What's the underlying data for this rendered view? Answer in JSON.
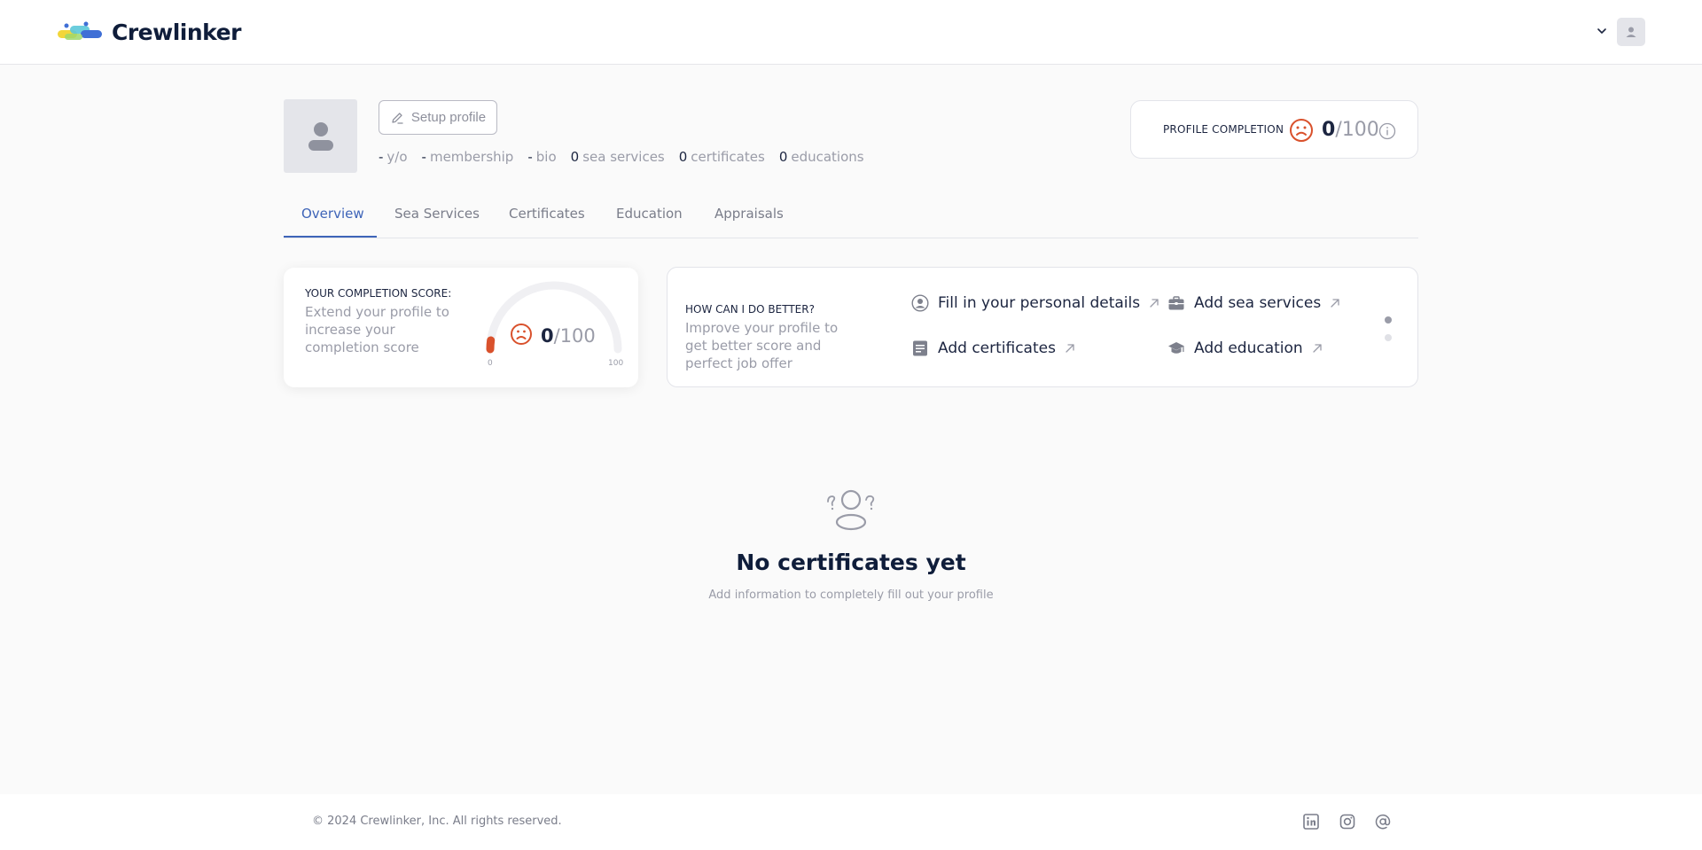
{
  "header": {
    "brand": "Crewlinker"
  },
  "profile": {
    "setup_label": "Setup profile",
    "stats": [
      {
        "value": "-",
        "label": "y/o"
      },
      {
        "value": "-",
        "label": "membership"
      },
      {
        "value": "-",
        "label": "bio"
      },
      {
        "value": "0",
        "label": "sea services"
      },
      {
        "value": "0",
        "label": "certificates"
      },
      {
        "value": "0",
        "label": "educations"
      }
    ],
    "completion": {
      "label": "PROFILE COMPLETION",
      "score": "0",
      "max": "/100"
    }
  },
  "tabs": [
    {
      "label": "Overview",
      "active": true
    },
    {
      "label": "Sea Services"
    },
    {
      "label": "Certificates"
    },
    {
      "label": "Education"
    },
    {
      "label": "Appraisals"
    }
  ],
  "score_card": {
    "title": "YOUR COMPLETION SCORE:",
    "description": "Extend your profile to increase your completion score",
    "score": "0",
    "max": "/100",
    "gauge_min": "0",
    "gauge_max": "100",
    "gauge_fraction": 0.0
  },
  "better_card": {
    "title": "HOW CAN I DO BETTER?",
    "description": "Improve your profile to get better score and perfect job offer",
    "actions": [
      {
        "label": "Fill in your personal details",
        "icon": "user-circle-icon"
      },
      {
        "label": "Add sea services",
        "icon": "briefcase-icon"
      },
      {
        "label": "Add certificates",
        "icon": "document-icon"
      },
      {
        "label": "Add education",
        "icon": "graduation-cap-icon"
      }
    ]
  },
  "empty_state": {
    "title": "No certificates yet",
    "subtitle": "Add information to completely fill out your profile"
  },
  "footer": {
    "copyright": "© 2024 Crewlinker, Inc. All rights reserved.",
    "social": [
      "linkedin-icon",
      "instagram-icon",
      "email-at-icon"
    ]
  },
  "colors": {
    "accent": "#3e64b8",
    "sad_face": "#d9512c",
    "text_dark": "#0f1d3a",
    "text_muted": "#9a9ca8"
  }
}
